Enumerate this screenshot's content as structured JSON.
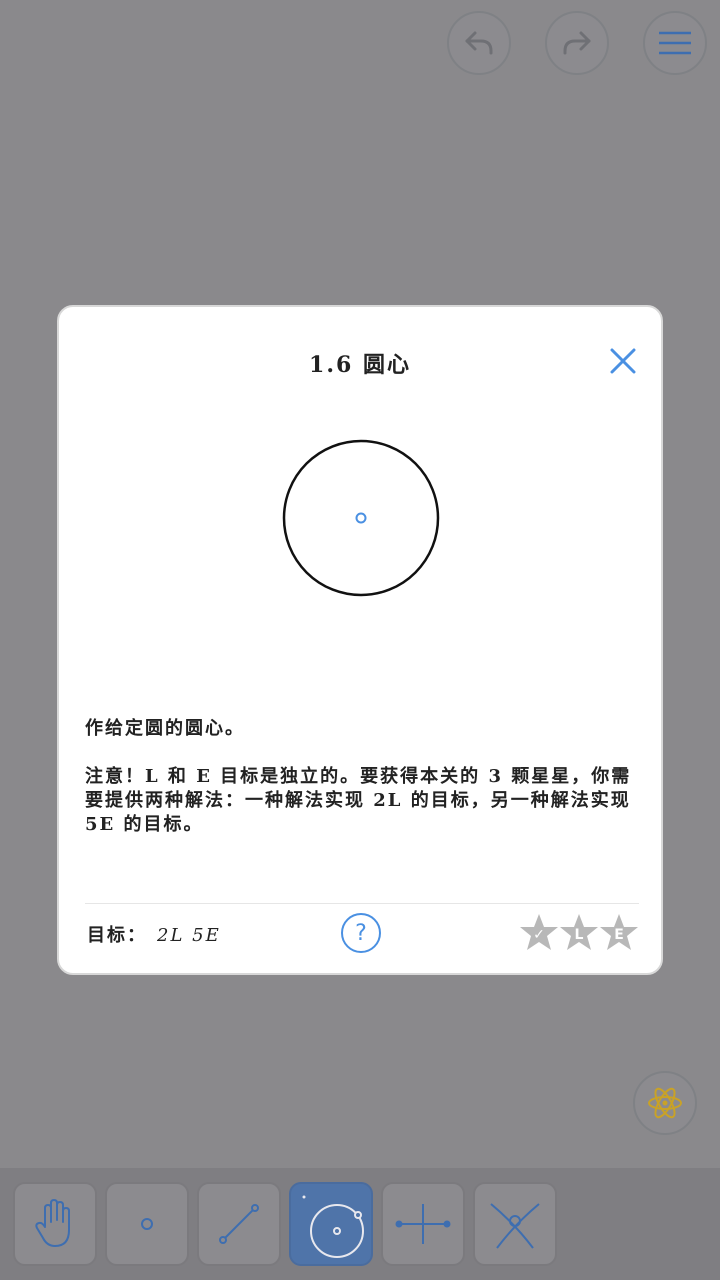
{
  "dialog": {
    "title": "1.6 圆心",
    "description": "作给定圆的圆心。",
    "note": "注意！L 和 E 目标是独立的。要获得本关的 3 颗星星，你需要提供两种解法：一种解法实现 2L 的目标，另一种解法实现 5E 的目标。",
    "goal_label": "目标：",
    "goal_values": "2L 5E",
    "help_label": "?",
    "stars": [
      {
        "label": "✓",
        "earned": false
      },
      {
        "label": "L",
        "earned": false
      },
      {
        "label": "E",
        "earned": false
      }
    ]
  },
  "toolbar": {
    "tools": [
      "move",
      "point",
      "line",
      "circle",
      "perpendicular-bisector",
      "intersect"
    ],
    "active_tool": "circle"
  },
  "colors": {
    "accent": "#4a90e2",
    "overlay": "#8a898c",
    "active_tool": "#4f74a9",
    "star_gray": "#b8b8b8",
    "atom_gold": "#c9a227"
  }
}
